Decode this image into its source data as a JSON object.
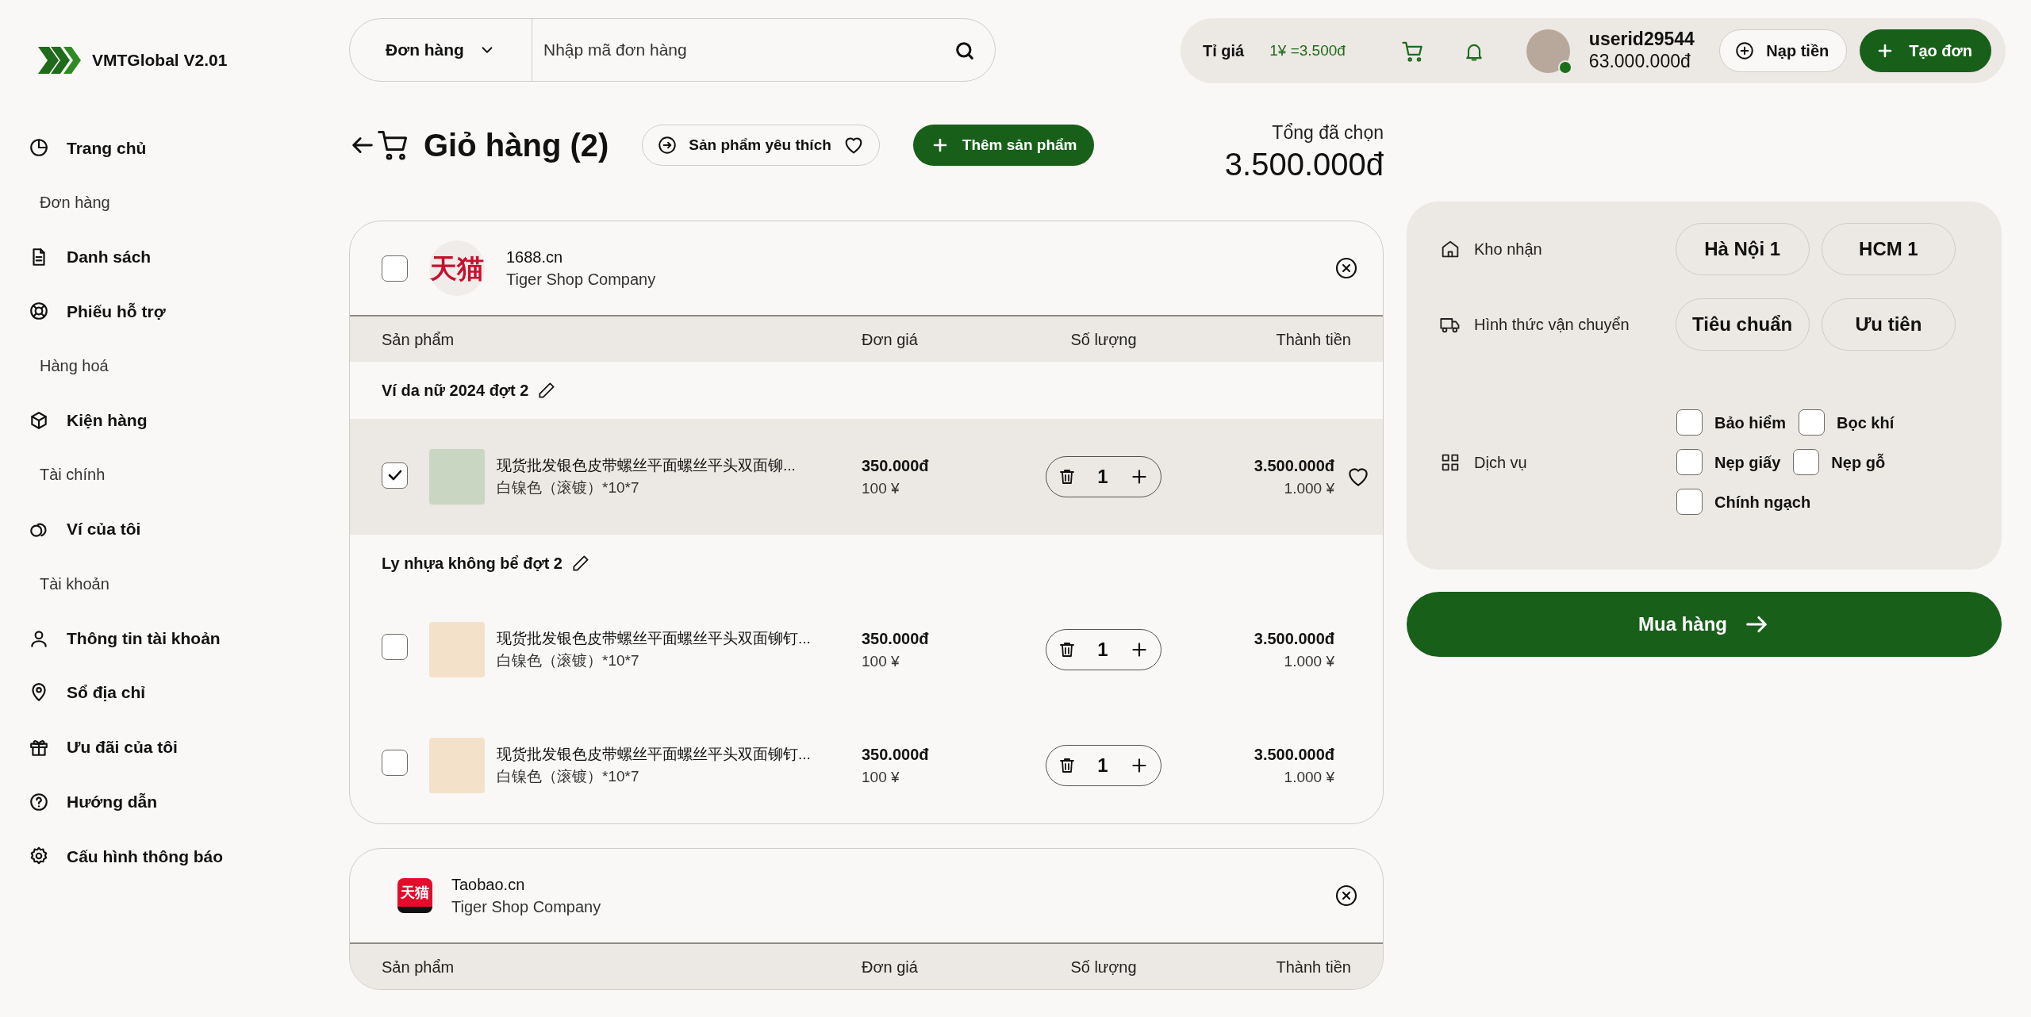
{
  "app": {
    "name": "VMTGlobal V2.01"
  },
  "search": {
    "scope": "Đơn hàng",
    "placeholder": "Nhập mã đơn hàng"
  },
  "topbar": {
    "rate_label": "Tỉ giá",
    "rate": "1¥ =3.500đ",
    "user": {
      "name": "userid29544",
      "balance": "63.000.000đ",
      "online": true
    },
    "buttons": [
      {
        "label": "Nạp tiền",
        "kind": "outline"
      },
      {
        "label": "Tạo đơn",
        "kind": "primary"
      }
    ]
  },
  "sidebar": {
    "items": [
      {
        "label": "Trang chủ",
        "kind": "link"
      },
      {
        "label": "Đơn hàng",
        "kind": "section"
      },
      {
        "label": "Danh sách",
        "kind": "link"
      },
      {
        "label": "Phiếu hỗ trợ",
        "kind": "link"
      },
      {
        "label": "Hàng hoá",
        "kind": "section"
      },
      {
        "label": "Kiện hàng",
        "kind": "link"
      },
      {
        "label": "Tài chính",
        "kind": "section"
      },
      {
        "label": "Ví của tôi",
        "kind": "link"
      },
      {
        "label": "Tài khoản",
        "kind": "section"
      },
      {
        "label": "Thông tin tài khoản",
        "kind": "link"
      },
      {
        "label": "Sổ địa chỉ",
        "kind": "link"
      },
      {
        "label": "Ưu đãi của tôi",
        "kind": "link"
      },
      {
        "label": "Hướng dẫn",
        "kind": "link"
      },
      {
        "label": "Cấu hình thông báo",
        "kind": "link"
      }
    ]
  },
  "page": {
    "title": "Giỏ hàng (2)",
    "favorites_button": "Sản phẩm yêu thích",
    "add_button": "Thêm sản phẩm",
    "total_label": "Tổng đã chọn",
    "total": "3.500.000đ"
  },
  "shops": [
    {
      "site": "1688.cn",
      "company": "Tiger Shop Company",
      "logo_text": "天猫",
      "kind": "round",
      "checked": false,
      "columns": [
        "Sản phẩm",
        "Đơn giá",
        "Số lượng",
        "Thành tiền"
      ],
      "groups": [
        {
          "name": "Ví da nữ 2024 đợt 2",
          "items": [
            {
              "name": "现货批发银色皮带螺丝平面螺丝平头双面铆...",
              "variant": "白镍色（滚镀）*10*7",
              "price": "350.000đ",
              "price_cny": "100 ¥",
              "quantity": "1",
              "total": "3.500.000đ",
              "total_cny": "1.000 ¥",
              "checked": true,
              "selected": true
            }
          ]
        },
        {
          "name": "Ly nhựa không bể đợt 2",
          "items": [
            {
              "name": "现货批发银色皮带螺丝平面螺丝平头双面铆钉...",
              "variant": "白镍色（滚镀）*10*7",
              "price": "350.000đ",
              "price_cny": "100 ¥",
              "quantity": "1",
              "total": "3.500.000đ",
              "total_cny": "1.000 ¥",
              "checked": false,
              "selected": false
            },
            {
              "name": "现货批发银色皮带螺丝平面螺丝平头双面铆钉...",
              "variant": "白镍色（滚镀）*10*7",
              "price": "350.000đ",
              "price_cny": "100 ¥",
              "quantity": "1",
              "total": "3.500.000đ",
              "total_cny": "1.000 ¥",
              "checked": false,
              "selected": false
            }
          ]
        }
      ]
    },
    {
      "site": "Taobao.cn",
      "company": "Tiger Shop Company",
      "logo_text": "天猫",
      "kind": "square",
      "columns": [
        "Sản phẩm",
        "Đơn giá",
        "Số lượng",
        "Thành tiền"
      ]
    }
  ],
  "options": {
    "rows": [
      {
        "label": "Kho nhận",
        "kind": "warehouse",
        "choices": [
          {
            "label": "Hà Nội 1",
            "selected": false
          },
          {
            "label": "HCM 1",
            "selected": false
          }
        ]
      },
      {
        "label": "Hình thức vận chuyển",
        "kind": "shipping",
        "choices": [
          {
            "label": "Tiêu chuẩn",
            "selected": false
          },
          {
            "label": "Ưu tiên",
            "selected": false
          }
        ]
      }
    ],
    "services": {
      "label": "Dịch vụ",
      "choices": [
        {
          "label": "Bảo hiểm",
          "checked": false
        },
        {
          "label": "Bọc khí",
          "checked": false
        },
        {
          "label": "Nẹp giấy",
          "checked": false
        },
        {
          "label": "Nẹp gỗ",
          "checked": false
        },
        {
          "label": "Chính ngạch",
          "checked": false
        }
      ]
    }
  },
  "buy_button": "Mua hàng"
}
